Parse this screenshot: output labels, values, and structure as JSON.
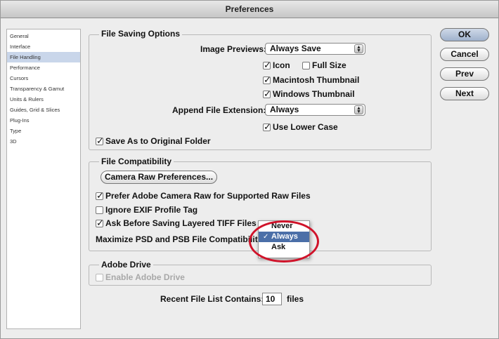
{
  "window": {
    "title": "Preferences"
  },
  "sidebar": {
    "items": [
      {
        "label": "General"
      },
      {
        "label": "Interface"
      },
      {
        "label": "File Handling"
      },
      {
        "label": "Performance"
      },
      {
        "label": "Cursors"
      },
      {
        "label": "Transparency & Gamut"
      },
      {
        "label": "Units & Rulers"
      },
      {
        "label": "Guides, Grid & Slices"
      },
      {
        "label": "Plug-Ins"
      },
      {
        "label": "Type"
      },
      {
        "label": "3D"
      }
    ],
    "selected": "File Handling"
  },
  "file_saving": {
    "title": "File Saving Options",
    "image_previews_label": "Image Previews:",
    "image_previews_value": "Always Save",
    "icon": {
      "label": "Icon",
      "checked": true
    },
    "full_size": {
      "label": "Full Size",
      "checked": false
    },
    "mac_thumb": {
      "label": "Macintosh Thumbnail",
      "checked": true
    },
    "win_thumb": {
      "label": "Windows Thumbnail",
      "checked": true
    },
    "append_label": "Append File Extension:",
    "append_value": "Always",
    "lower_case": {
      "label": "Use Lower Case",
      "checked": true
    },
    "save_original": {
      "label": "Save As to Original Folder",
      "checked": true
    }
  },
  "compat": {
    "title": "File Compatibility",
    "camera_raw_button": "Camera Raw Preferences...",
    "prefer_acr": {
      "label": "Prefer Adobe Camera Raw for Supported Raw Files",
      "checked": true
    },
    "ignore_exif": {
      "label": "Ignore EXIF Profile Tag",
      "checked": false
    },
    "ask_tiff": {
      "label": "Ask Before Saving Layered TIFF Files",
      "checked": true
    },
    "maximize_label": "Maximize PSD and PSB File Compatibility:",
    "menu": {
      "options": [
        "Never",
        "Always",
        "Ask"
      ],
      "selected": "Always",
      "check": "✓"
    }
  },
  "drive": {
    "title": "Adobe Drive",
    "enable": {
      "label": "Enable Adobe Drive",
      "checked": false
    }
  },
  "recent": {
    "label": "Recent File List Contains:",
    "value": "10",
    "suffix": "files"
  },
  "buttons": {
    "ok": "OK",
    "cancel": "Cancel",
    "prev": "Prev",
    "next": "Next"
  },
  "colors": {
    "highlight": "#d0132a",
    "selection": "#4b6fa8",
    "sidebar_selection": "#c9d6ea"
  }
}
